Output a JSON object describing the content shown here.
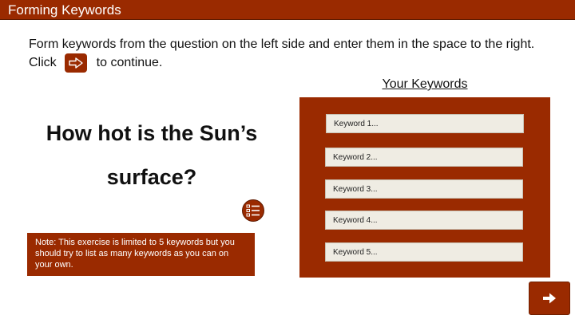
{
  "header": {
    "title": "Forming Keywords"
  },
  "instructions": {
    "line1": "Form keywords from the question on the left side and enter them in the space to the right.",
    "click_label": "Click",
    "continue_label": "to continue."
  },
  "question": {
    "text": "How hot is the Sun’s surface?"
  },
  "note": {
    "text": "Note: This exercise is limited to 5 keywords but you should try to list as many keywords as you can on your own."
  },
  "keywords": {
    "title": "Your Keywords",
    "fields": [
      {
        "placeholder": "Keyword 1...",
        "value": ""
      },
      {
        "placeholder": "Keyword 2...",
        "value": ""
      },
      {
        "placeholder": "Keyword 3...",
        "value": ""
      },
      {
        "placeholder": "Keyword 4...",
        "value": ""
      },
      {
        "placeholder": "Keyword 5...",
        "value": ""
      }
    ]
  },
  "icons": {
    "continue": "arrow-right-outline-icon",
    "menu": "checklist-icon",
    "next": "arrow-right-icon"
  },
  "colors": {
    "accent": "#9a2a00",
    "input_bg": "#efece3",
    "text": "#1a1a1a"
  }
}
